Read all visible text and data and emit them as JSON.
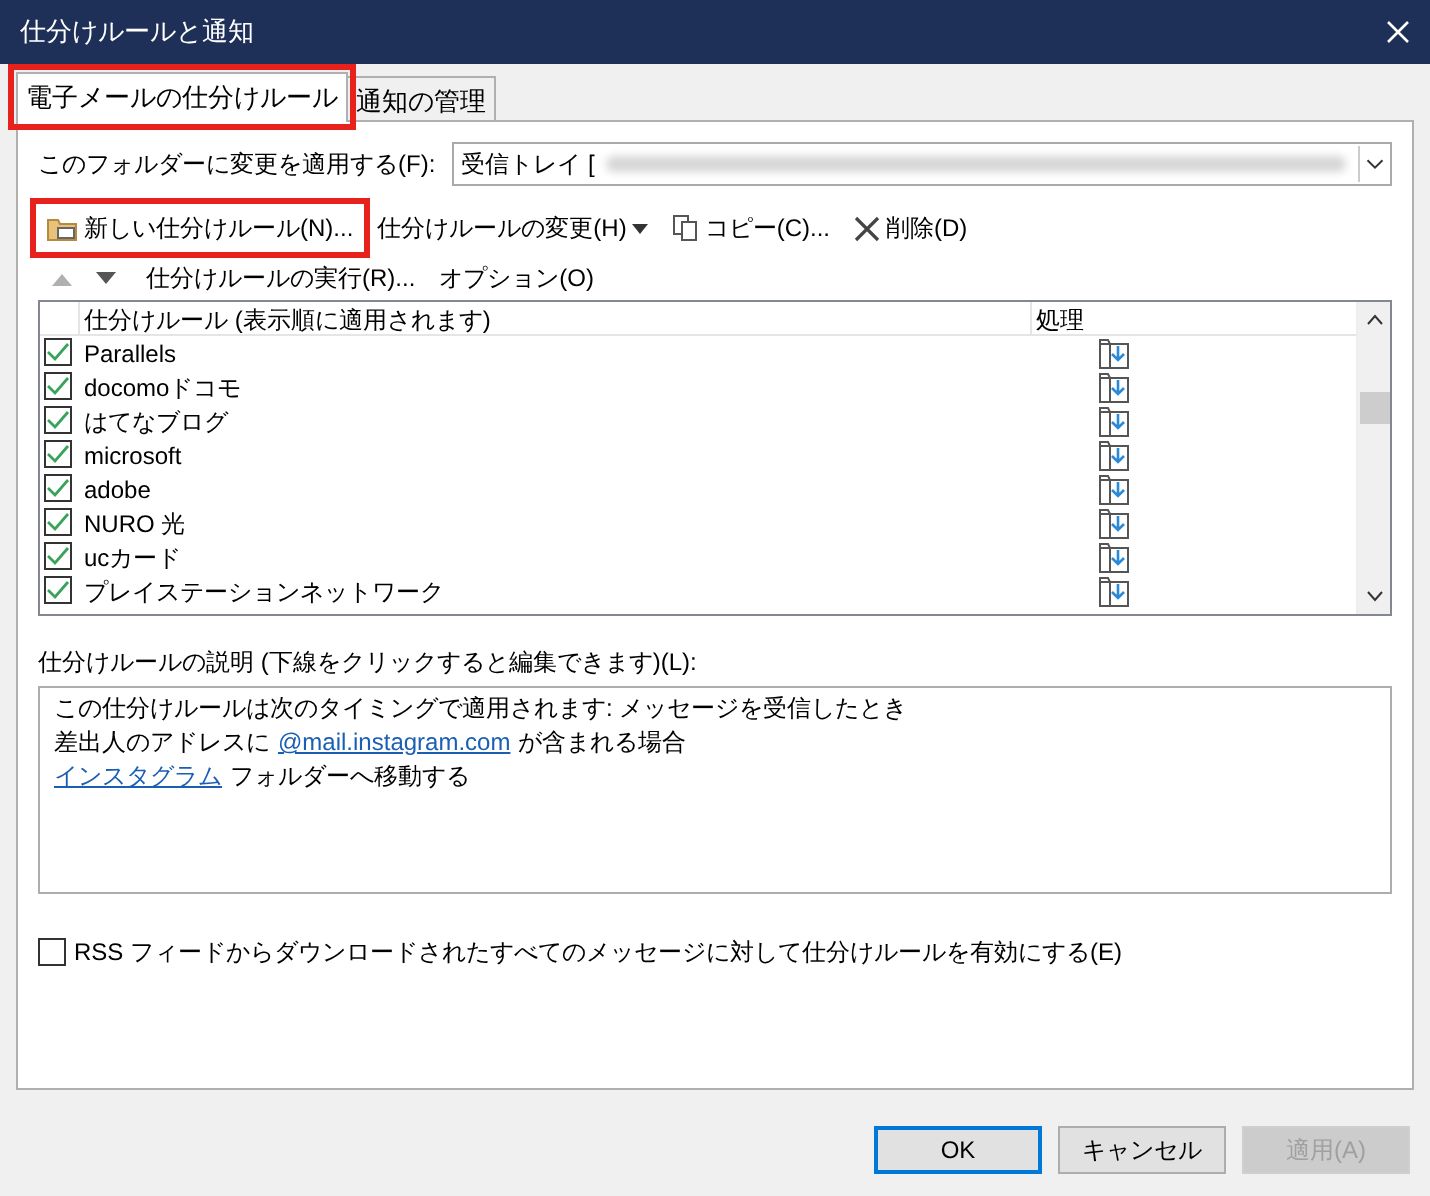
{
  "window": {
    "title": "仕分けルールと通知"
  },
  "tabs": [
    {
      "label": "電子メールの仕分けルール",
      "selected": true,
      "highlighted": true
    },
    {
      "label": "通知の管理",
      "selected": false,
      "highlighted": false
    }
  ],
  "folder": {
    "label": "このフォルダーに変更を適用する(F):",
    "value": "受信トレイ ["
  },
  "toolbar": [
    {
      "label": "新しい仕分けルール(N)...",
      "kind": "new",
      "highlighted": true,
      "dropdown": false
    },
    {
      "label": "仕分けルールの変更(H)",
      "kind": "plain",
      "highlighted": false,
      "dropdown": true
    },
    {
      "label": "コピー(C)...",
      "kind": "copy",
      "highlighted": false,
      "dropdown": false
    },
    {
      "label": "削除(D)",
      "kind": "delete",
      "highlighted": false,
      "dropdown": false
    }
  ],
  "toolbar2": [
    {
      "label": "仕分けルールの実行(R)..."
    },
    {
      "label": "オプション(O)"
    }
  ],
  "rules_table": {
    "columns": [
      "仕分けルール (表示順に適用されます)",
      "処理"
    ],
    "rows": [
      {
        "name": "Parallels",
        "checked": true
      },
      {
        "name": "docomoドコモ",
        "checked": true
      },
      {
        "name": "はてなブログ",
        "checked": true
      },
      {
        "name": "microsoft",
        "checked": true
      },
      {
        "name": "adobe",
        "checked": true
      },
      {
        "name": "NURO 光",
        "checked": true
      },
      {
        "name": "ucカード",
        "checked": true
      },
      {
        "name": "プレイステーションネットワーク",
        "checked": true
      }
    ]
  },
  "description": {
    "label": "仕分けルールの説明 (下線をクリックすると編集できます)(L):",
    "lines": [
      [
        {
          "text": "この仕分けルールは次のタイミングで適用されます: メッセージを受信したとき",
          "link": false
        }
      ],
      [
        {
          "text": "差出人のアドレスに",
          "link": false
        },
        {
          "text": "@mail.instagram.com",
          "link": true
        },
        {
          "text": "が含まれる場合",
          "link": false
        }
      ],
      [
        {
          "text": "インスタグラム",
          "link": true
        },
        {
          "text": "フォルダーへ移動する",
          "link": false
        }
      ]
    ]
  },
  "rss_option": {
    "label": "RSS フィードからダウンロードされたすべてのメッセージに対して仕分けルールを有効にする(E)",
    "checked": false
  },
  "buttons": [
    {
      "label": "OK",
      "default": true,
      "disabled": false
    },
    {
      "label": "キャンセル",
      "default": false,
      "disabled": false
    },
    {
      "label": "適用(A)",
      "default": false,
      "disabled": true
    }
  ]
}
